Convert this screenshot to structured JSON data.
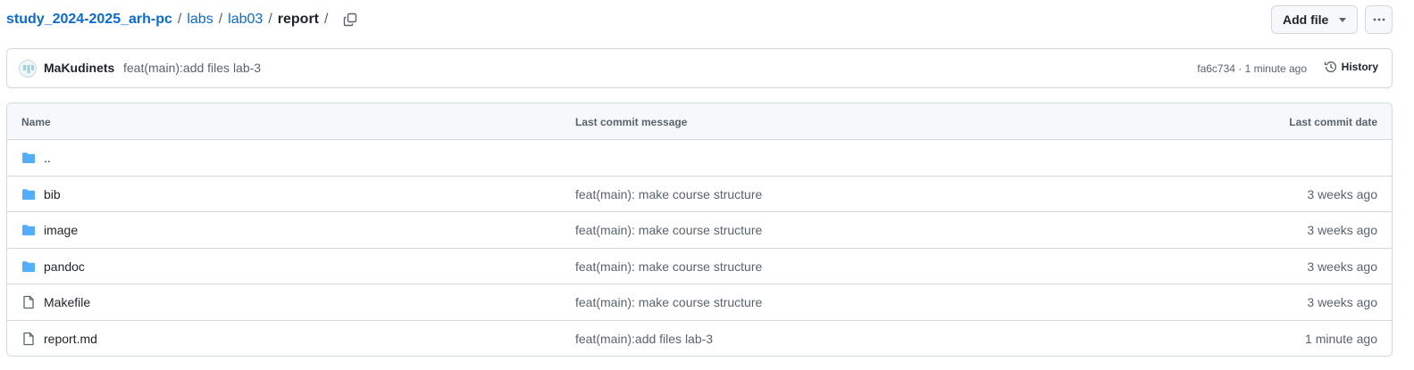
{
  "breadcrumb": {
    "root": "study_2024-2025_arh-pc",
    "seg1": "labs",
    "seg2": "lab03",
    "current": "report",
    "sep": "/"
  },
  "toolbar": {
    "add_file_label": "Add file",
    "more_icon": "kebab-horizontal-icon"
  },
  "commit": {
    "author": "MaKudinets",
    "message": "feat(main):add files lab-3",
    "meta": "fa6c734 · 1 minute ago",
    "history_label": "History"
  },
  "table": {
    "headers": {
      "name": "Name",
      "message": "Last commit message",
      "date": "Last commit date"
    },
    "rows": [
      {
        "name": "..",
        "type": "folder",
        "message": "",
        "date": ""
      },
      {
        "name": "bib",
        "type": "folder",
        "message": "feat(main): make course structure",
        "date": "3 weeks ago"
      },
      {
        "name": "image",
        "type": "folder",
        "message": "feat(main): make course structure",
        "date": "3 weeks ago"
      },
      {
        "name": "pandoc",
        "type": "folder",
        "message": "feat(main): make course structure",
        "date": "3 weeks ago"
      },
      {
        "name": "Makefile",
        "type": "file",
        "message": "feat(main): make course structure",
        "date": "3 weeks ago"
      },
      {
        "name": "report.md",
        "type": "file",
        "message": "feat(main):add files lab-3",
        "date": "1 minute ago"
      }
    ]
  },
  "colors": {
    "link": "#0969da",
    "folder": "#54aeff",
    "muted": "#59636e",
    "border": "#d1d9e0"
  }
}
